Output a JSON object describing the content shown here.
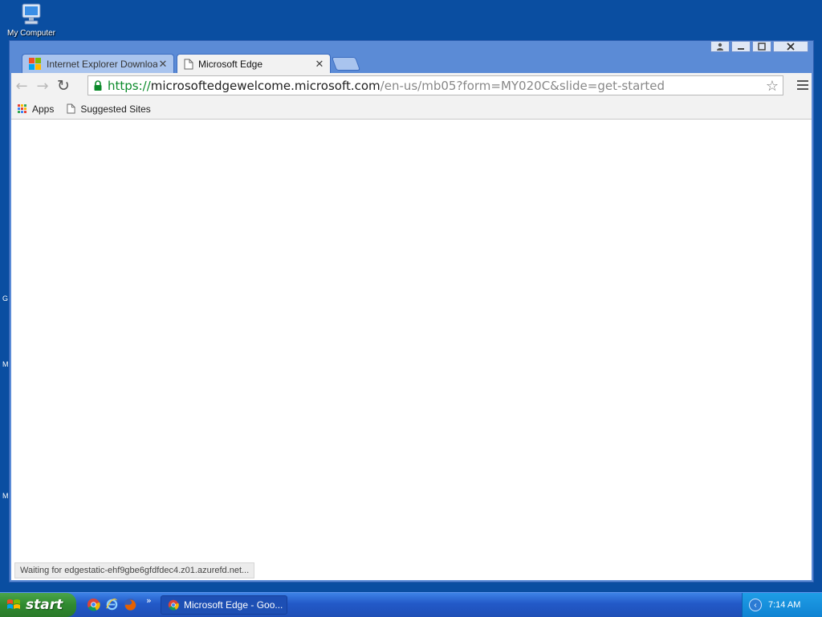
{
  "desktop": {
    "icons": [
      {
        "label": "My Computer",
        "icon": "computer-icon"
      }
    ],
    "edge_letters": [
      "G",
      "M",
      "M"
    ]
  },
  "browser": {
    "tabs": [
      {
        "title": "Internet Explorer Downloads",
        "icon": "microsoft-logo-icon",
        "active": false
      },
      {
        "title": "Microsoft Edge",
        "icon": "page-icon",
        "active": true
      }
    ],
    "url": {
      "scheme": "https://",
      "host": "microsoftedgewelcome.microsoft.com",
      "path": "/en-us/mb05?form=MY020C&slide=get-started"
    },
    "bookmarks": [
      {
        "label": "Apps",
        "icon": "apps-grid-icon"
      },
      {
        "label": "Suggested Sites",
        "icon": "page-icon"
      }
    ],
    "status": "Waiting for edgestatic-ehf9gbe6gfdfdec4.z01.azurefd.net..."
  },
  "taskbar": {
    "start_label": "start",
    "quick_launch": [
      "chrome-icon",
      "ie-icon",
      "firefox-icon"
    ],
    "tasks": [
      {
        "label": "Microsoft Edge - Goo...",
        "icon": "chrome-icon"
      }
    ],
    "clock": "7:14 AM"
  },
  "colors": {
    "desktop": "#0a4ea1",
    "taskbar": "#2259c7",
    "start": "#3a963a",
    "secure_url": "#0b8a2a"
  }
}
